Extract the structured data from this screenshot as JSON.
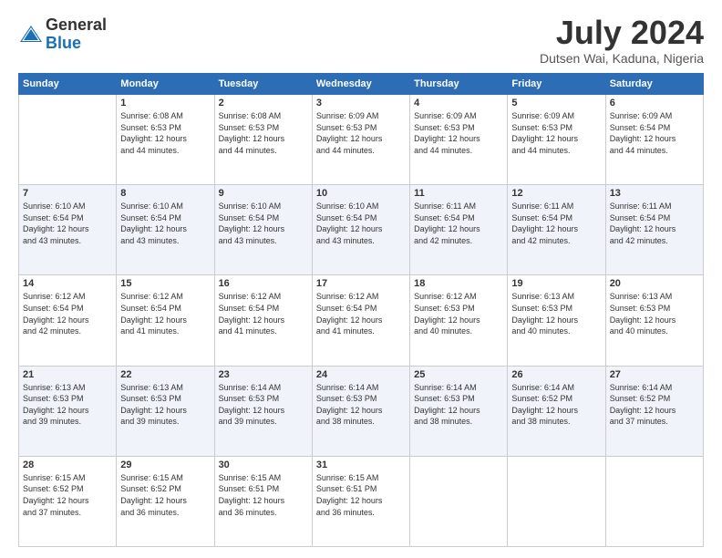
{
  "logo": {
    "general": "General",
    "blue": "Blue"
  },
  "title": {
    "month": "July 2024",
    "location": "Dutsen Wai, Kaduna, Nigeria"
  },
  "columns": [
    "Sunday",
    "Monday",
    "Tuesday",
    "Wednesday",
    "Thursday",
    "Friday",
    "Saturday"
  ],
  "weeks": [
    [
      {
        "day": "",
        "info": ""
      },
      {
        "day": "1",
        "info": "Sunrise: 6:08 AM\nSunset: 6:53 PM\nDaylight: 12 hours\nand 44 minutes."
      },
      {
        "day": "2",
        "info": "Sunrise: 6:08 AM\nSunset: 6:53 PM\nDaylight: 12 hours\nand 44 minutes."
      },
      {
        "day": "3",
        "info": "Sunrise: 6:09 AM\nSunset: 6:53 PM\nDaylight: 12 hours\nand 44 minutes."
      },
      {
        "day": "4",
        "info": "Sunrise: 6:09 AM\nSunset: 6:53 PM\nDaylight: 12 hours\nand 44 minutes."
      },
      {
        "day": "5",
        "info": "Sunrise: 6:09 AM\nSunset: 6:53 PM\nDaylight: 12 hours\nand 44 minutes."
      },
      {
        "day": "6",
        "info": "Sunrise: 6:09 AM\nSunset: 6:54 PM\nDaylight: 12 hours\nand 44 minutes."
      }
    ],
    [
      {
        "day": "7",
        "info": "Sunrise: 6:10 AM\nSunset: 6:54 PM\nDaylight: 12 hours\nand 43 minutes."
      },
      {
        "day": "8",
        "info": "Sunrise: 6:10 AM\nSunset: 6:54 PM\nDaylight: 12 hours\nand 43 minutes."
      },
      {
        "day": "9",
        "info": "Sunrise: 6:10 AM\nSunset: 6:54 PM\nDaylight: 12 hours\nand 43 minutes."
      },
      {
        "day": "10",
        "info": "Sunrise: 6:10 AM\nSunset: 6:54 PM\nDaylight: 12 hours\nand 43 minutes."
      },
      {
        "day": "11",
        "info": "Sunrise: 6:11 AM\nSunset: 6:54 PM\nDaylight: 12 hours\nand 42 minutes."
      },
      {
        "day": "12",
        "info": "Sunrise: 6:11 AM\nSunset: 6:54 PM\nDaylight: 12 hours\nand 42 minutes."
      },
      {
        "day": "13",
        "info": "Sunrise: 6:11 AM\nSunset: 6:54 PM\nDaylight: 12 hours\nand 42 minutes."
      }
    ],
    [
      {
        "day": "14",
        "info": "Sunrise: 6:12 AM\nSunset: 6:54 PM\nDaylight: 12 hours\nand 42 minutes."
      },
      {
        "day": "15",
        "info": "Sunrise: 6:12 AM\nSunset: 6:54 PM\nDaylight: 12 hours\nand 41 minutes."
      },
      {
        "day": "16",
        "info": "Sunrise: 6:12 AM\nSunset: 6:54 PM\nDaylight: 12 hours\nand 41 minutes."
      },
      {
        "day": "17",
        "info": "Sunrise: 6:12 AM\nSunset: 6:54 PM\nDaylight: 12 hours\nand 41 minutes."
      },
      {
        "day": "18",
        "info": "Sunrise: 6:12 AM\nSunset: 6:53 PM\nDaylight: 12 hours\nand 40 minutes."
      },
      {
        "day": "19",
        "info": "Sunrise: 6:13 AM\nSunset: 6:53 PM\nDaylight: 12 hours\nand 40 minutes."
      },
      {
        "day": "20",
        "info": "Sunrise: 6:13 AM\nSunset: 6:53 PM\nDaylight: 12 hours\nand 40 minutes."
      }
    ],
    [
      {
        "day": "21",
        "info": "Sunrise: 6:13 AM\nSunset: 6:53 PM\nDaylight: 12 hours\nand 39 minutes."
      },
      {
        "day": "22",
        "info": "Sunrise: 6:13 AM\nSunset: 6:53 PM\nDaylight: 12 hours\nand 39 minutes."
      },
      {
        "day": "23",
        "info": "Sunrise: 6:14 AM\nSunset: 6:53 PM\nDaylight: 12 hours\nand 39 minutes."
      },
      {
        "day": "24",
        "info": "Sunrise: 6:14 AM\nSunset: 6:53 PM\nDaylight: 12 hours\nand 38 minutes."
      },
      {
        "day": "25",
        "info": "Sunrise: 6:14 AM\nSunset: 6:53 PM\nDaylight: 12 hours\nand 38 minutes."
      },
      {
        "day": "26",
        "info": "Sunrise: 6:14 AM\nSunset: 6:52 PM\nDaylight: 12 hours\nand 38 minutes."
      },
      {
        "day": "27",
        "info": "Sunrise: 6:14 AM\nSunset: 6:52 PM\nDaylight: 12 hours\nand 37 minutes."
      }
    ],
    [
      {
        "day": "28",
        "info": "Sunrise: 6:15 AM\nSunset: 6:52 PM\nDaylight: 12 hours\nand 37 minutes."
      },
      {
        "day": "29",
        "info": "Sunrise: 6:15 AM\nSunset: 6:52 PM\nDaylight: 12 hours\nand 36 minutes."
      },
      {
        "day": "30",
        "info": "Sunrise: 6:15 AM\nSunset: 6:51 PM\nDaylight: 12 hours\nand 36 minutes."
      },
      {
        "day": "31",
        "info": "Sunrise: 6:15 AM\nSunset: 6:51 PM\nDaylight: 12 hours\nand 36 minutes."
      },
      {
        "day": "",
        "info": ""
      },
      {
        "day": "",
        "info": ""
      },
      {
        "day": "",
        "info": ""
      }
    ]
  ]
}
